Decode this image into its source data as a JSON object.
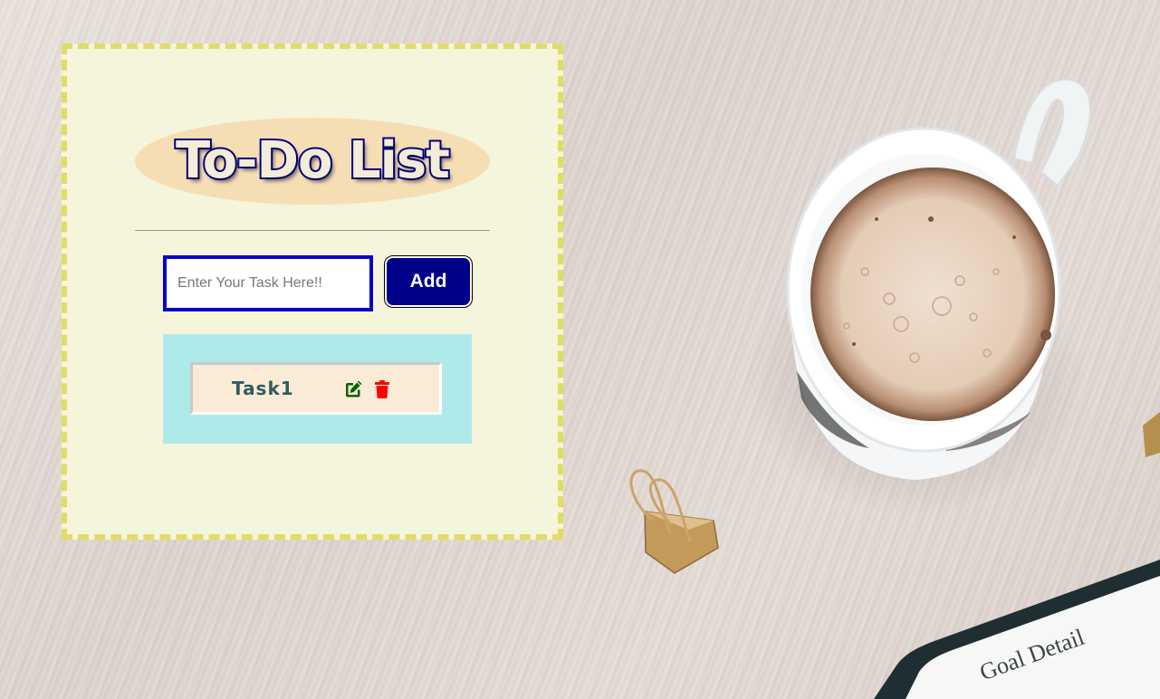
{
  "app": {
    "title": "To-Do List"
  },
  "input": {
    "placeholder": "Enter Your Task Here!!",
    "value": ""
  },
  "actions": {
    "add_label": "Add"
  },
  "tasks": [
    {
      "text": "Task1",
      "edit_icon": "edit-icon",
      "delete_icon": "trash-icon"
    }
  ],
  "background": {
    "card_text": "Goal Detail"
  },
  "colors": {
    "card_bg": "#f5f5dc",
    "card_border": "#e1dc68",
    "title_bg": "#f5deb3",
    "title_stroke": "#000080",
    "input_border": "#0000cd",
    "add_button_bg": "#00008b",
    "list_bg": "#afeaea",
    "task_bg": "#faebd7",
    "edit_icon": "#006400",
    "delete_icon": "#ff0000"
  }
}
